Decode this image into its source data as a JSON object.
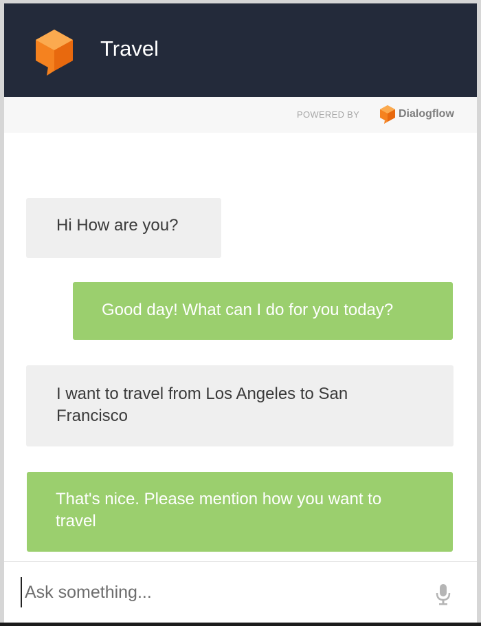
{
  "header": {
    "title": "Travel",
    "logo_icon": "dialogflow-cube-icon",
    "background": "#232a3a"
  },
  "powered_by": {
    "label": "POWERED BY",
    "brand": "Dialogflow",
    "brand_icon": "dialogflow-logo-icon"
  },
  "messages": [
    {
      "sender": "agent",
      "text": "Hi How are you?"
    },
    {
      "sender": "user",
      "text": "Good day! What can I do for you today?"
    },
    {
      "sender": "agent",
      "text": "I want to travel from Los Angeles to San Francisco"
    },
    {
      "sender": "user",
      "text": "That's nice. Please mention how you want to travel"
    }
  ],
  "input": {
    "placeholder": "Ask something...",
    "value": "",
    "mic_icon": "microphone-icon"
  },
  "colors": {
    "accent_orange": "#f5821f",
    "user_bubble": "#9bcf6e",
    "agent_bubble": "#efefef"
  }
}
